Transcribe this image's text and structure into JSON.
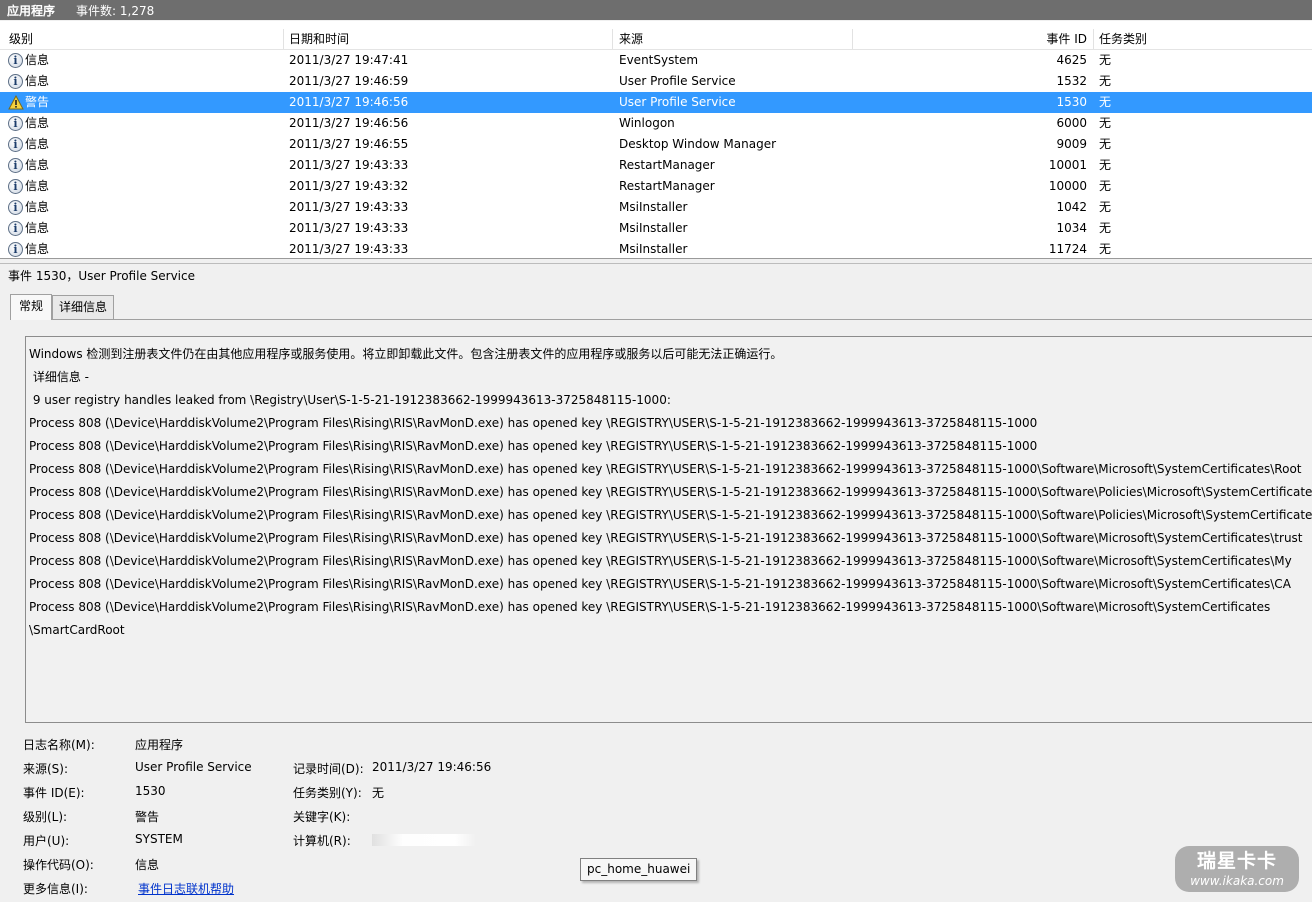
{
  "header": {
    "log_name": "应用程序",
    "event_count": "事件数: 1,278"
  },
  "columns": {
    "level": "级别",
    "datetime": "日期和时间",
    "source": "来源",
    "event_id": "事件 ID",
    "task": "任务类别"
  },
  "events": [
    {
      "level": "信息",
      "icon": "info-icon",
      "datetime": "2011/3/27 19:47:41",
      "source": "EventSystem",
      "event_id": "4625",
      "task": "无",
      "selected": false
    },
    {
      "level": "信息",
      "icon": "info-icon",
      "datetime": "2011/3/27 19:46:59",
      "source": "User Profile Service",
      "event_id": "1532",
      "task": "无",
      "selected": false
    },
    {
      "level": "警告",
      "icon": "warning-icon",
      "datetime": "2011/3/27 19:46:56",
      "source": "User Profile Service",
      "event_id": "1530",
      "task": "无",
      "selected": true
    },
    {
      "level": "信息",
      "icon": "info-icon",
      "datetime": "2011/3/27 19:46:56",
      "source": "Winlogon",
      "event_id": "6000",
      "task": "无",
      "selected": false
    },
    {
      "level": "信息",
      "icon": "info-icon",
      "datetime": "2011/3/27 19:46:55",
      "source": "Desktop Window Manager",
      "event_id": "9009",
      "task": "无",
      "selected": false
    },
    {
      "level": "信息",
      "icon": "info-icon",
      "datetime": "2011/3/27 19:43:33",
      "source": "RestartManager",
      "event_id": "10001",
      "task": "无",
      "selected": false
    },
    {
      "level": "信息",
      "icon": "info-icon",
      "datetime": "2011/3/27 19:43:32",
      "source": "RestartManager",
      "event_id": "10000",
      "task": "无",
      "selected": false
    },
    {
      "level": "信息",
      "icon": "info-icon",
      "datetime": "2011/3/27 19:43:33",
      "source": "MsiInstaller",
      "event_id": "1042",
      "task": "无",
      "selected": false
    },
    {
      "level": "信息",
      "icon": "info-icon",
      "datetime": "2011/3/27 19:43:33",
      "source": "MsiInstaller",
      "event_id": "1034",
      "task": "无",
      "selected": false
    },
    {
      "level": "信息",
      "icon": "info-icon",
      "datetime": "2011/3/27 19:43:33",
      "source": "MsiInstaller",
      "event_id": "11724",
      "task": "无",
      "selected": false
    }
  ],
  "detail": {
    "title": "事件 1530，User Profile Service",
    "tabs": [
      "常规",
      "详细信息"
    ],
    "description": [
      "Windows 检测到注册表文件仍在由其他应用程序或服务使用。将立即卸载此文件。包含注册表文件的应用程序或服务以后可能无法正确运行。",
      "",
      " 详细信息 -",
      " 9 user registry handles leaked from \\Registry\\User\\S-1-5-21-1912383662-1999943613-3725848115-1000:",
      "Process 808 (\\Device\\HarddiskVolume2\\Program Files\\Rising\\RIS\\RavMonD.exe) has opened key \\REGISTRY\\USER\\S-1-5-21-1912383662-1999943613-3725848115-1000",
      "Process 808 (\\Device\\HarddiskVolume2\\Program Files\\Rising\\RIS\\RavMonD.exe) has opened key \\REGISTRY\\USER\\S-1-5-21-1912383662-1999943613-3725848115-1000",
      "Process 808 (\\Device\\HarddiskVolume2\\Program Files\\Rising\\RIS\\RavMonD.exe) has opened key \\REGISTRY\\USER\\S-1-5-21-1912383662-1999943613-3725848115-1000\\Software\\Microsoft\\SystemCertificates\\Root",
      "Process 808 (\\Device\\HarddiskVolume2\\Program Files\\Rising\\RIS\\RavMonD.exe) has opened key \\REGISTRY\\USER\\S-1-5-21-1912383662-1999943613-3725848115-1000\\Software\\Policies\\Microsoft\\SystemCertificates",
      "Process 808 (\\Device\\HarddiskVolume2\\Program Files\\Rising\\RIS\\RavMonD.exe) has opened key \\REGISTRY\\USER\\S-1-5-21-1912383662-1999943613-3725848115-1000\\Software\\Policies\\Microsoft\\SystemCertificates",
      "Process 808 (\\Device\\HarddiskVolume2\\Program Files\\Rising\\RIS\\RavMonD.exe) has opened key \\REGISTRY\\USER\\S-1-5-21-1912383662-1999943613-3725848115-1000\\Software\\Microsoft\\SystemCertificates\\trust",
      "Process 808 (\\Device\\HarddiskVolume2\\Program Files\\Rising\\RIS\\RavMonD.exe) has opened key \\REGISTRY\\USER\\S-1-5-21-1912383662-1999943613-3725848115-1000\\Software\\Microsoft\\SystemCertificates\\My",
      "Process 808 (\\Device\\HarddiskVolume2\\Program Files\\Rising\\RIS\\RavMonD.exe) has opened key \\REGISTRY\\USER\\S-1-5-21-1912383662-1999943613-3725848115-1000\\Software\\Microsoft\\SystemCertificates\\CA",
      "Process 808 (\\Device\\HarddiskVolume2\\Program Files\\Rising\\RIS\\RavMonD.exe) has opened key \\REGISTRY\\USER\\S-1-5-21-1912383662-1999943613-3725848115-1000\\Software\\Microsoft\\SystemCertificates",
      "\\SmartCardRoot"
    ]
  },
  "properties": {
    "log_name_label": "日志名称(M):",
    "log_name_value": "应用程序",
    "source_label": "来源(S):",
    "source_value": "User Profile Service",
    "logged_label": "记录时间(D):",
    "logged_value": "2011/3/27 19:46:56",
    "event_id_label": "事件 ID(E):",
    "event_id_value": "1530",
    "task_label": "任务类别(Y):",
    "task_value": "无",
    "level_label": "级别(L):",
    "level_value": "警告",
    "keywords_label": "关键字(K):",
    "user_label": "用户(U):",
    "user_value": "SYSTEM",
    "computer_label": "计算机(R):",
    "opcode_label": "操作代码(O):",
    "opcode_value": "信息",
    "more_info_label": "更多信息(I):",
    "more_info_link": "事件日志联机帮助"
  },
  "tooltip": "pc_home_huawei",
  "watermark": {
    "line1": "瑞星卡卡",
    "line2": "www.ikaka.com"
  }
}
